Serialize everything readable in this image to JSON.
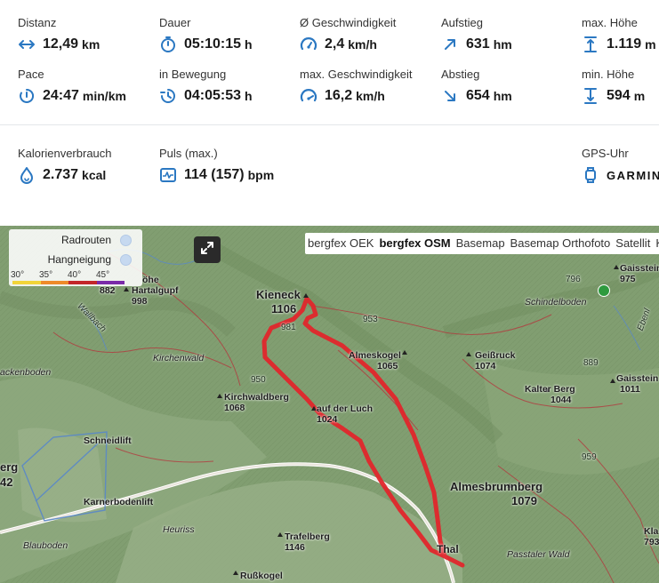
{
  "stats": {
    "distance": {
      "label": "Distanz",
      "value": "12,49",
      "unit": "km",
      "icon": "distance-arrows-icon"
    },
    "duration": {
      "label": "Dauer",
      "value": "05:10:15",
      "unit": "h",
      "icon": "stopwatch-icon"
    },
    "avg_speed": {
      "label": "Ø Geschwindigkeit",
      "value": "2,4",
      "unit": "km/h",
      "icon": "speedometer-icon"
    },
    "ascent": {
      "label": "Aufstieg",
      "value": "631",
      "unit": "hm",
      "icon": "arrow-up-right-icon"
    },
    "max_height": {
      "label": "max. Höhe",
      "value": "1.119",
      "unit": "m",
      "icon": "height-max-icon"
    },
    "pace": {
      "label": "Pace",
      "value": "24:47",
      "unit": "min/km",
      "icon": "pace-timer-icon"
    },
    "moving": {
      "label": "in Bewegung",
      "value": "04:05:53",
      "unit": "h",
      "icon": "moving-clock-icon"
    },
    "max_speed": {
      "label": "max. Geschwindigkeit",
      "value": "16,2",
      "unit": "km/h",
      "icon": "speedometer-max-icon"
    },
    "descent": {
      "label": "Abstieg",
      "value": "654",
      "unit": "hm",
      "icon": "arrow-down-right-icon"
    },
    "min_height": {
      "label": "min. Höhe",
      "value": "594",
      "unit": "m",
      "icon": "height-min-icon"
    },
    "calories": {
      "label": "Kalorienverbrauch",
      "value": "2.737",
      "unit": "kcal",
      "icon": "flame-drop-icon"
    },
    "pulse": {
      "label": "Puls (max.)",
      "value": "114 (157)",
      "unit": "bpm",
      "icon": "heart-rate-icon"
    },
    "device": {
      "label": "GPS-Uhr",
      "brand": "GARMIN",
      "icon": "watch-icon"
    }
  },
  "colors": {
    "accent": "#2b78c2",
    "route": "#e0262b",
    "terrain": "#7e9b6e",
    "divider": "#e3e6ea"
  },
  "map": {
    "legend": {
      "cycle_routes": "Radrouten",
      "slope": "Hangneigung",
      "slope_steps": [
        "30°",
        "35°",
        "40°",
        "45°"
      ],
      "slope_colors": [
        "#f2d43a",
        "#ee8a2a",
        "#c3262a",
        "#7a2aa8"
      ]
    },
    "layers": [
      "bergfex OEK",
      "bergfex OSM",
      "Basemap",
      "Basemap Orthofoto",
      "Satellit",
      "K"
    ],
    "active_layer": "bergfex OSM",
    "labels": {
      "kieneck": "Kieneck",
      "kieneck_elev": "1106",
      "almeskogel": "Almeskogel",
      "almeskogel_elev": "1065",
      "geissruck": "Geißruck",
      "geissruck_elev": "1074",
      "kalter_berg": "Kalter Berg",
      "kalter_berg_elev": "1044",
      "gaisstein_top": "Gaisstein",
      "gaisstein_top_elev": "975",
      "gaisstein_right": "Gaisstein",
      "gaisstein_right_elev": "1011",
      "schindelboden": "Schindelboden",
      "hartalgupf": "Hartalgupf",
      "hartalgupf_elev": "998",
      "kirchenwald": "Kirchenwald",
      "kirchwaldberg": "Kirchwaldberg",
      "kirchwaldberg_elev": "1068",
      "auf_der_luch": "auf der Luch",
      "auf_der_luch_elev": "1024",
      "almesbrunnberg": "Almesbrunnberg",
      "almesbrunnberg_elev": "1079",
      "schneidlift": "Schneidlift",
      "karnerbodenlift": "Karnerbodenlift",
      "heuriss": "Heuriss",
      "trafelberg": "Trafelberg",
      "trafelberg_elev": "1146",
      "russkogel": "Rußkogel",
      "thal": "Thal",
      "passtaler_wald": "Passtaler Wald",
      "blauboden": "Blauboden",
      "ackenboden": "ackenboden",
      "hohe": "öhe",
      "elev_882": "882",
      "elev_981": "981",
      "elev_953": "953",
      "elev_950": "950",
      "elev_889": "889",
      "elev_959": "959",
      "elev_796": "796",
      "elev_42": "42",
      "berg_left": "erg",
      "kla": "Kla",
      "kla_elev": "793",
      "wallbach": "Wallbach",
      "ebenl": "Ebenl"
    }
  }
}
